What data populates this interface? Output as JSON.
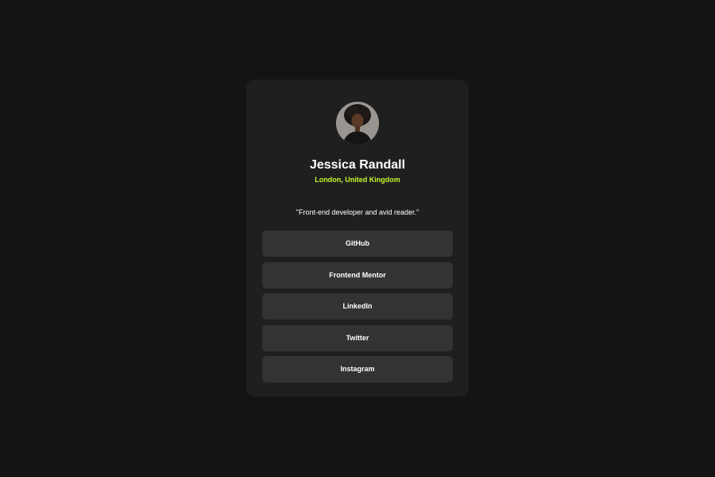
{
  "profile": {
    "name": "Jessica Randall",
    "location": "London, United Kingdom",
    "bio": "\"Front-end developer and avid reader.\""
  },
  "links": [
    {
      "label": "GitHub"
    },
    {
      "label": "Frontend Mentor"
    },
    {
      "label": "LinkedIn"
    },
    {
      "label": "Twitter"
    },
    {
      "label": "Instagram"
    }
  ],
  "colors": {
    "page_background": "#141414",
    "card_background": "#1f1f1f",
    "button_background": "#333333",
    "accent": "#c4f82a",
    "text": "#ffffff"
  }
}
